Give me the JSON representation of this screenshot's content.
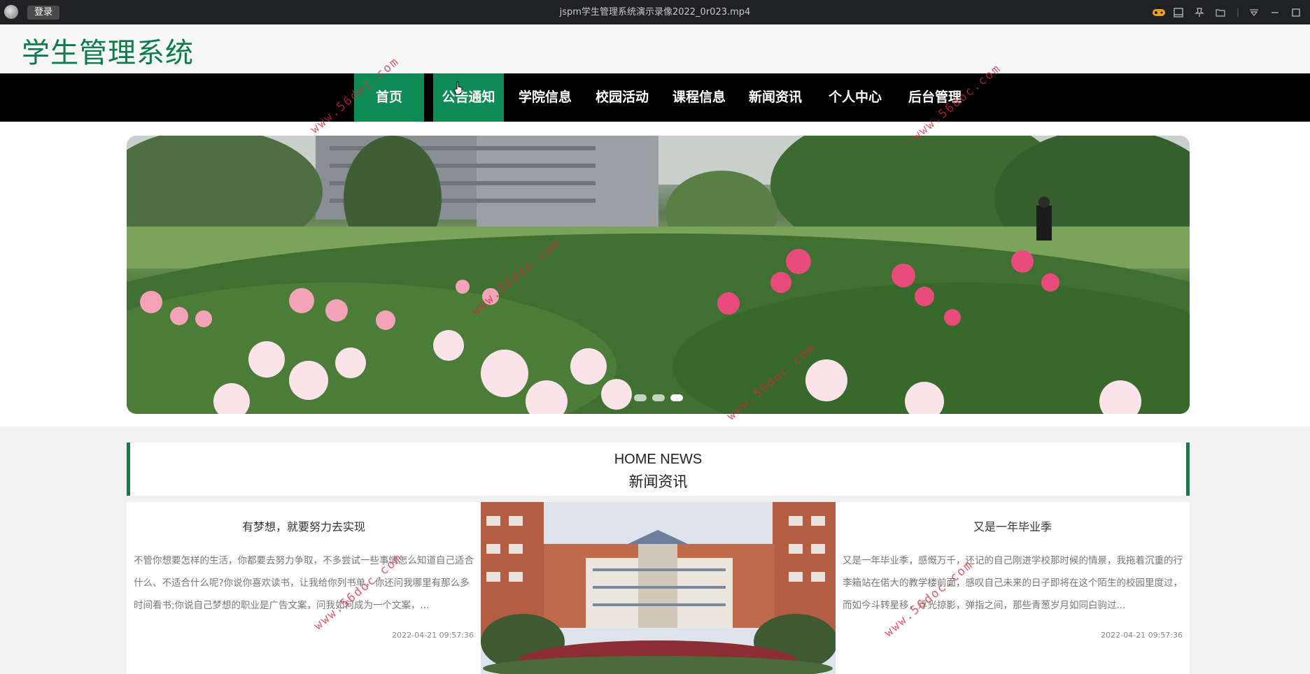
{
  "player": {
    "login_label": "登录",
    "title": "jspm学生管理系统演示录像2022_0r023.mp4"
  },
  "site": {
    "title": "学生管理系统"
  },
  "nav": {
    "items": [
      {
        "label": "首页"
      },
      {
        "label": "公告通知"
      },
      {
        "label": "学院信息"
      },
      {
        "label": "校园活动"
      },
      {
        "label": "课程信息"
      },
      {
        "label": "新闻资讯"
      },
      {
        "label": "个人中心"
      },
      {
        "label": "后台管理"
      }
    ]
  },
  "news": {
    "heading_en": "HOME NEWS",
    "heading_cn": "新闻资讯",
    "cards": [
      {
        "title": "有梦想，就要努力去实现",
        "text": "不管你想要怎样的生活，你都要去努力争取，不多尝试一些事情怎么知道自己适合什么、不适合什么呢?你说你喜欢读书，让我给你列书单，你还问我哪里有那么多时间看书;你说自己梦想的职业是广告文案，问我如何成为一个文案，...",
        "date": "2022-04-21 09:57:36"
      },
      {
        "title": "又是一年毕业季",
        "text": "又是一年毕业季，感慨万千，还记的自己刚进学校那时候的情景，我拖着沉重的行李箱站在偌大的教学楼前面，感叹自己未来的日子即将在这个陌生的校园里度过，而如今斗转星移，浮光掠影，弹指之间，那些青葱岁月如同白驹过...",
        "date": "2022-04-21 09:57:36"
      }
    ]
  },
  "watermark": "www.56doc.com",
  "colors": {
    "brand_green": "#0e7b4a",
    "nav_active": "#0e8a55",
    "nav_bg": "#000000"
  }
}
